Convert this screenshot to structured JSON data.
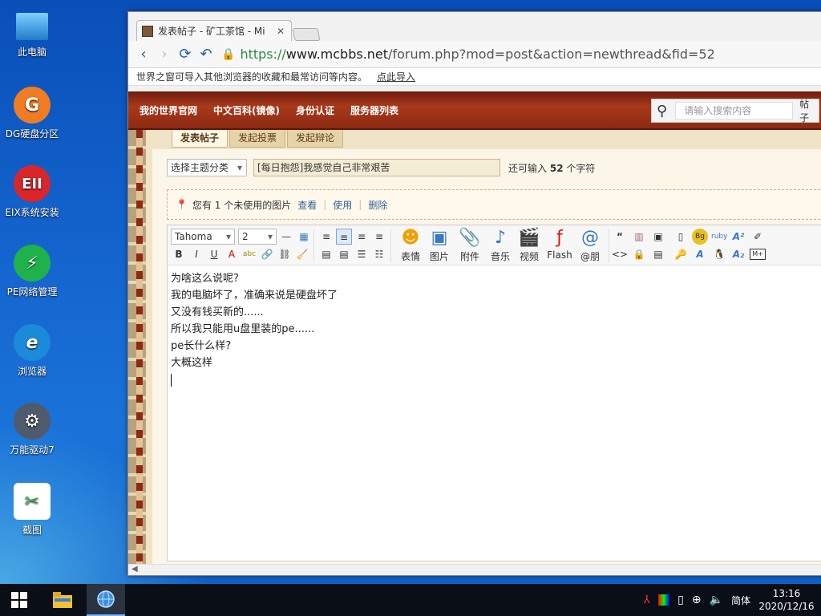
{
  "desktop": {
    "icons": [
      {
        "label": "此电脑",
        "icon": "computer-icon",
        "color": "#4aa3e6"
      },
      {
        "label": "DG硬盘分区",
        "icon": "dg-disk-icon",
        "color": "#f07d23"
      },
      {
        "label": "EIX系统安装",
        "icon": "eix-icon",
        "color": "#d8262b"
      },
      {
        "label": "PE网络管理",
        "icon": "pe-network-icon",
        "color": "#1fb24a"
      },
      {
        "label": "浏览器",
        "icon": "ie-browser-icon",
        "color": "#1b8ad8"
      },
      {
        "label": "万能驱动7",
        "icon": "gear-icon",
        "color": "#4f5b6b"
      },
      {
        "label": "截图",
        "icon": "screenshot-icon",
        "color": "#2ea84a"
      }
    ]
  },
  "browser": {
    "tab_title": "发表帖子 - 矿工茶馆 - Mi",
    "url_scheme": "https://",
    "url_host": "www.mcbbs.net",
    "url_path": "/forum.php?mod=post&action=newthread&fid=52",
    "infobar_text": "世界之窗可导入其他浏览器的收藏和最常访问等内容。",
    "infobar_link": "点此导入"
  },
  "site": {
    "nav": [
      "我的世界官网",
      "中文百科(镜像)",
      "身份认证",
      "服务器列表"
    ],
    "search_placeholder": "请输入搜索内容",
    "search_more": "帖子",
    "post_tabs": [
      "发表帖子",
      "发起投票",
      "发起辩论"
    ]
  },
  "form": {
    "category_select": "选择主题分类",
    "title_value": "[每日抱怨]我感觉自己非常艰苦",
    "remain_prefix": "还可输入",
    "remain_count": "52",
    "remain_suffix": "个字符",
    "notice_text": "您有 1 个未使用的图片",
    "notice_view": "查看",
    "notice_use": "使用",
    "notice_delete": "删除"
  },
  "editor": {
    "font": "Tahoma",
    "size": "2",
    "big_buttons": [
      {
        "label": "表情",
        "icon": "smiley-icon"
      },
      {
        "label": "图片",
        "icon": "image-icon"
      },
      {
        "label": "附件",
        "icon": "paperclip-icon"
      },
      {
        "label": "音乐",
        "icon": "music-note-icon"
      },
      {
        "label": "视频",
        "icon": "video-icon"
      },
      {
        "label": "Flash",
        "icon": "flash-icon"
      },
      {
        "label": "@朋",
        "icon": "at-icon"
      }
    ],
    "lines": [
      "为啥这么说呢?",
      "我的电脑坏了，准确来说是硬盘坏了",
      "又没有钱买新的......",
      "所以我只能用u盘里装的pe......",
      "pe长什么样?",
      "大概这样"
    ]
  },
  "taskbar": {
    "ime": "简体",
    "time": "13:16",
    "date": "2020/12/16"
  }
}
